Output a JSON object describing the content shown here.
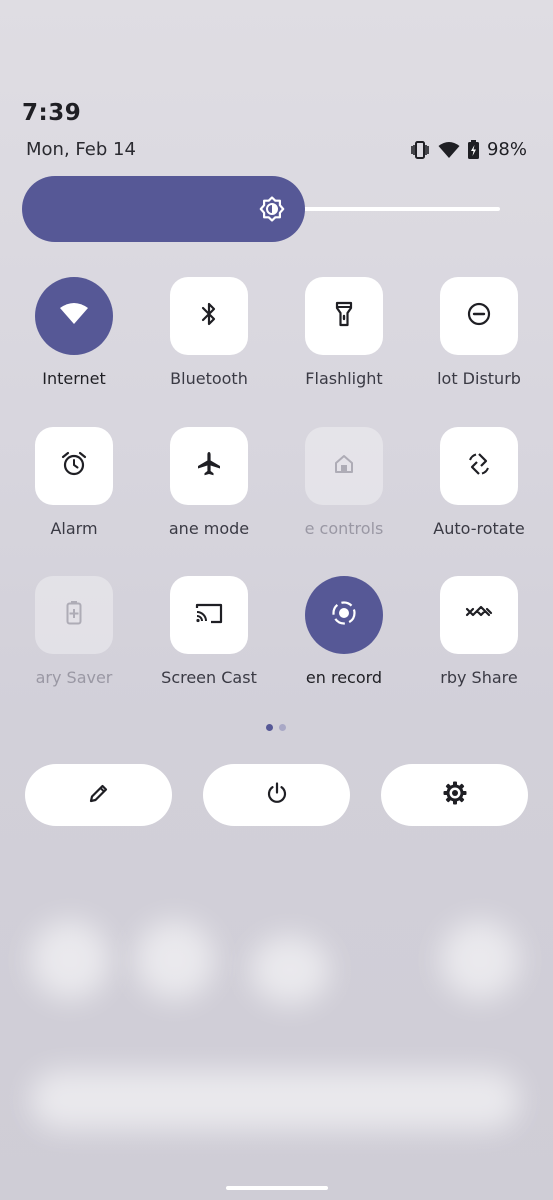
{
  "status_bar": {
    "time": "7:39",
    "date": "Mon, Feb 14",
    "battery": "98%",
    "icons": [
      "vibrate-icon",
      "wifi-icon",
      "battery-charging-icon"
    ]
  },
  "brightness": {
    "level": 0.59,
    "icon": "brightness-icon"
  },
  "tiles": [
    {
      "label": "Internet",
      "icon": "wifi-icon",
      "state": "active"
    },
    {
      "label": "Bluetooth",
      "icon": "bluetooth-icon",
      "state": "off"
    },
    {
      "label": "Flashlight",
      "icon": "flashlight-icon",
      "state": "off"
    },
    {
      "label": "lot Disturb",
      "icon": "do-not-disturb-icon",
      "state": "off"
    },
    {
      "label": "Alarm",
      "icon": "alarm-icon",
      "state": "off"
    },
    {
      "label": "ane mode",
      "icon": "airplane-icon",
      "state": "off"
    },
    {
      "label": "e controls",
      "icon": "home-icon",
      "state": "disabled"
    },
    {
      "label": "Auto-rotate",
      "icon": "auto-rotate-icon",
      "state": "off"
    },
    {
      "label": "ary Saver",
      "icon": "battery-saver-icon",
      "state": "disabled"
    },
    {
      "label": "Screen Cast",
      "icon": "cast-icon",
      "state": "off"
    },
    {
      "label": "en record",
      "icon": "screen-record-icon",
      "state": "active"
    },
    {
      "label": "rby Share",
      "icon": "nearby-share-icon",
      "state": "off"
    }
  ],
  "pager": {
    "pages": 2,
    "current": 1
  },
  "footer": {
    "edit": "pencil-icon",
    "power": "power-icon",
    "settings": "gear-icon"
  },
  "colors": {
    "accent": "#565896",
    "tile": "#ffffff"
  }
}
